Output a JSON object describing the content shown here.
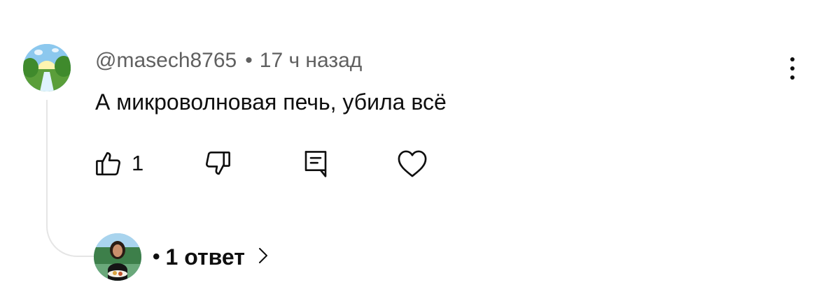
{
  "comment": {
    "author": "@masech8765",
    "separator": "•",
    "time": "17 ч назад",
    "text": "А микроволновая печь, убила всё",
    "like_count": "1"
  },
  "replies": {
    "bullet": "•",
    "label": "1 ответ"
  },
  "icons": {
    "more": "more-vert-icon",
    "like": "thumb-up-icon",
    "dislike": "thumb-down-icon",
    "reply": "reply-comment-icon",
    "heart": "heart-icon",
    "chevron": "chevron-right-icon"
  }
}
